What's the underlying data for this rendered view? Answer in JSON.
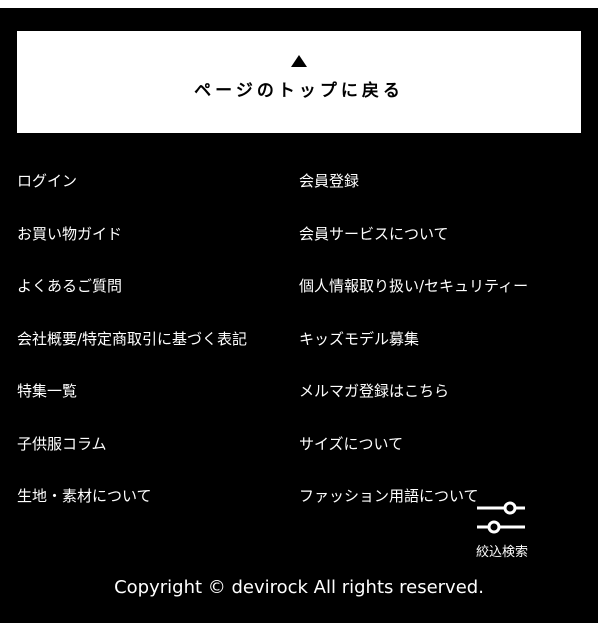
{
  "page_top": {
    "label": "ページのトップに戻る"
  },
  "menu": {
    "left": [
      {
        "label": "ログイン"
      },
      {
        "label": "お買い物ガイド"
      },
      {
        "label": "よくあるご質問"
      },
      {
        "label": "会社概要/特定商取引に基づく表記"
      },
      {
        "label": "特集一覧"
      },
      {
        "label": "子供服コラム"
      },
      {
        "label": "生地・素材について"
      }
    ],
    "right": [
      {
        "label": "会員登録"
      },
      {
        "label": "会員サービスについて"
      },
      {
        "label": "個人情報取り扱い/セキュリティー"
      },
      {
        "label": "キッズモデル募集"
      },
      {
        "label": "メルマガ登録はこちら"
      },
      {
        "label": "サイズについて"
      },
      {
        "label": "ファッション用語について"
      }
    ]
  },
  "filter": {
    "label": "絞込検索",
    "icon": "sliders-icon"
  },
  "footer": {
    "copyright": "Copyright © devirock All rights reserved."
  },
  "colors": {
    "background": "#000000",
    "text": "#ffffff",
    "button_background": "#ffffff",
    "button_text": "#000000"
  }
}
